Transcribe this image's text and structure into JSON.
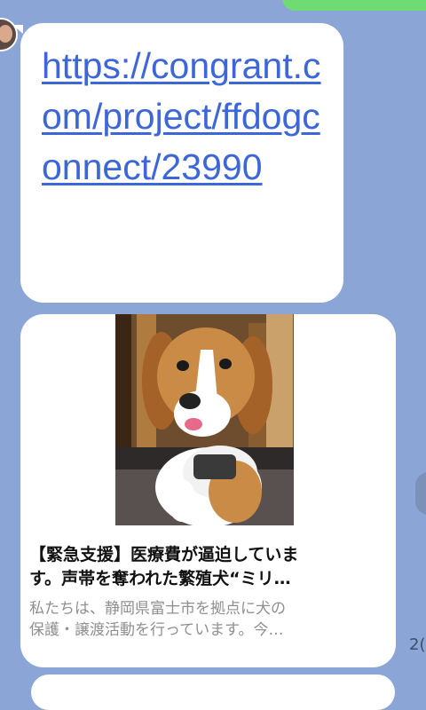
{
  "chat": {
    "message_link": {
      "url_text": "https://congrant.com/project/ffdogconnect/23990"
    },
    "link_card": {
      "image_icon": "beagle-photo",
      "title_line1": "【緊急支援】医療費が逼迫していま",
      "title_line2": "す。声帯を奪われた繁殖犬“ミリ…",
      "desc_line1": "私たちは、静岡県富士市を拠点に犬の",
      "desc_line2": "保護・譲渡活動を行っています。今…"
    },
    "timestamp_partial": "2("
  },
  "colors": {
    "background": "#8aa5d6",
    "link": "#3d67d8",
    "own_bubble": "#6fdc73"
  }
}
